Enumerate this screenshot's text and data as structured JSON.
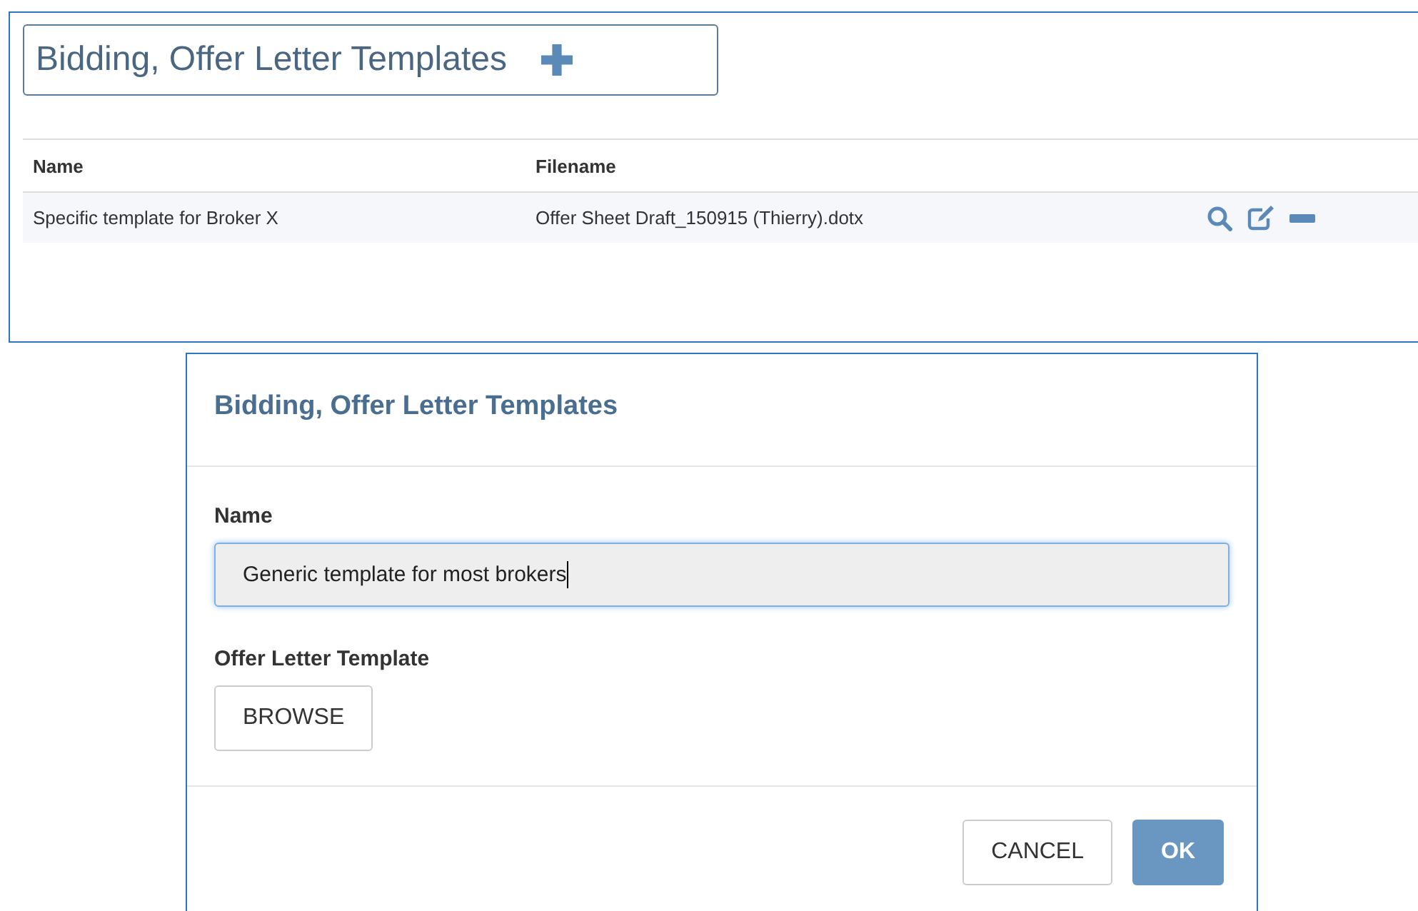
{
  "panel": {
    "title": "Bidding, Offer Letter Templates"
  },
  "table": {
    "columns": [
      "Name",
      "Filename"
    ],
    "rows": [
      {
        "name": "Specific template for Broker X",
        "filename": "Offer Sheet Draft_150915 (Thierry).dotx"
      }
    ]
  },
  "dialog": {
    "title": "Bidding, Offer Letter Templates",
    "name_label": "Name",
    "name_value": "Generic template for most brokers",
    "template_label": "Offer Letter Template",
    "browse": "BROWSE",
    "buttons": [
      {
        "label": "CANCEL",
        "kind": "default"
      },
      {
        "label": "OK",
        "kind": "primary"
      }
    ]
  }
}
